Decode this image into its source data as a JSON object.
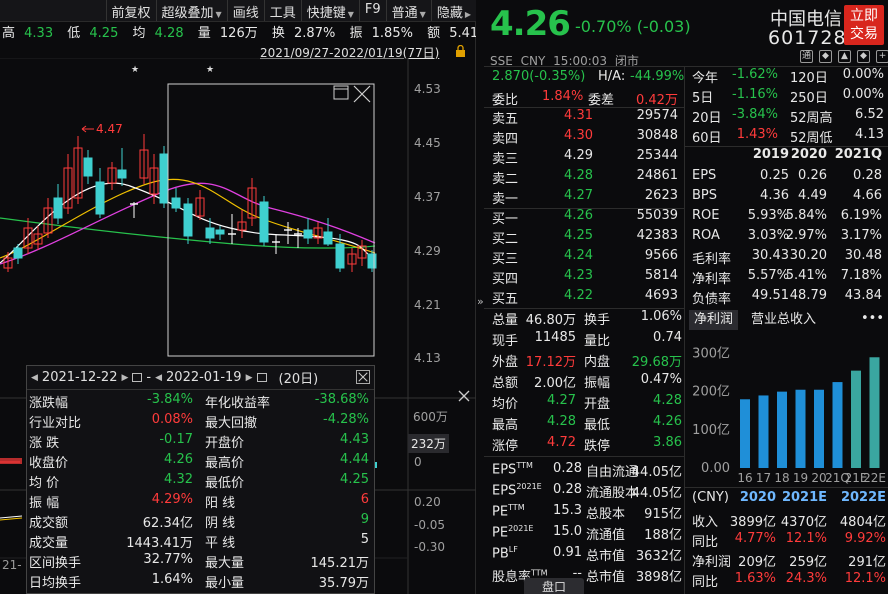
{
  "toolbar": {
    "items": [
      "前复权",
      "超级叠加",
      "画线",
      "工具",
      "快捷键",
      "F9",
      "普通",
      "隐藏"
    ]
  },
  "stats_line": {
    "high_label": "高",
    "high": "4.33",
    "low_label": "低",
    "low": "4.25",
    "avg_label": "均",
    "avg": "4.28",
    "vol_label": "量",
    "vol": "126万",
    "turnover_label": "换",
    "turnover": "2.87%",
    "amp_label": "振",
    "amp": "1.85%",
    "amount_label": "额",
    "amount": "5.41亿"
  },
  "range_text": "2021/09/27-2022/01/19(77日)",
  "main_chart": {
    "yticks": [
      "4.53",
      "4.45",
      "4.37",
      "4.29",
      "4.21",
      "4.13"
    ],
    "peak_label": "4.47",
    "star_mark": "★",
    "colors": {
      "up": "#ff3b3b",
      "down": "#3fd0d0",
      "ma5": "#ffffff",
      "ma10": "#f0c000",
      "ma20": "#e040e0",
      "ma60": "#27c24c"
    }
  },
  "popup": {
    "start_date": "2021-12-22",
    "sep": "-",
    "end_date": "2022-01-19",
    "days": "(20日)",
    "rows": [
      {
        "l1": "涨跌幅",
        "v1": "-3.84%",
        "c1": "dn",
        "l2": "年化收益率",
        "v2": "-38.68%",
        "c2": "dn"
      },
      {
        "l1": "行业对比",
        "v1": "0.08%",
        "c1": "up",
        "l2": "最大回撤",
        "v2": "-4.28%",
        "c2": "dn"
      },
      {
        "l1": "涨    跌",
        "v1": "-0.17",
        "c1": "dn",
        "l2": "开盘价",
        "v2": "4.43",
        "c2": "dn"
      },
      {
        "l1": "收盘价",
        "v1": "4.26",
        "c1": "dn",
        "l2": "最高价",
        "v2": "4.44",
        "c2": "dn"
      },
      {
        "l1": "均    价",
        "v1": "4.32",
        "c1": "dn",
        "l2": "最低价",
        "v2": "4.25",
        "c2": "dn"
      },
      {
        "l1": "振    幅",
        "v1": "4.29%",
        "c1": "up",
        "l2": "阳    线",
        "v2": "6",
        "c2": "up"
      },
      {
        "l1": "成交额",
        "v1": "62.34亿",
        "c1": "wh",
        "l2": "阴    线",
        "v2": "9",
        "c2": "dn"
      },
      {
        "l1": "成交量",
        "v1": "1443.41万",
        "c1": "wh",
        "l2": "平    线",
        "v2": "5",
        "c2": "wh"
      },
      {
        "l1": "区间换手",
        "v1": "32.77%",
        "c1": "wh",
        "l2": "最大量",
        "v2": "145.21万",
        "c2": "wh"
      },
      {
        "l1": "日均换手",
        "v1": "1.64%",
        "c1": "wh",
        "l2": "最小量",
        "v2": "35.79万",
        "c2": "wh"
      }
    ]
  },
  "vol_pane": {
    "label_top": "600万",
    "badge": "232万",
    "label_zero": "0"
  },
  "macd_pane": {
    "label_a": "0.20",
    "label_b": "-0.05",
    "label_c": "-0.30"
  },
  "bottom_left_label": "21-",
  "quote": {
    "price": "4.26",
    "change": "-0.70% (-0.03)",
    "name": "中国电信",
    "code": "601728",
    "trade_button": "立即交易",
    "exchange": "SSE",
    "currency": "CNY",
    "time": "15:00:03",
    "status": "闭市",
    "comp_value": "2.870(-0.35%)",
    "ha_label": "H/A:",
    "ha_value": "-44.99%"
  },
  "orderbook": {
    "ratio": {
      "l1": "委比",
      "v1": "1.84%",
      "l2": "委差",
      "v2": "0.42万"
    },
    "asks": [
      {
        "label": "卖五",
        "price": "4.31",
        "vol": "29574",
        "pc": "up"
      },
      {
        "label": "卖四",
        "price": "4.30",
        "vol": "30848",
        "pc": "up"
      },
      {
        "label": "卖三",
        "price": "4.29",
        "vol": "25344",
        "pc": "wh"
      },
      {
        "label": "卖二",
        "price": "4.28",
        "vol": "24861",
        "pc": "dn"
      },
      {
        "label": "卖一",
        "price": "4.27",
        "vol": "2623",
        "pc": "dn"
      }
    ],
    "bids": [
      {
        "label": "买一",
        "price": "4.26",
        "vol": "55039",
        "pc": "dn"
      },
      {
        "label": "买二",
        "price": "4.25",
        "vol": "42383",
        "pc": "dn"
      },
      {
        "label": "买三",
        "price": "4.24",
        "vol": "9566",
        "pc": "dn"
      },
      {
        "label": "买四",
        "price": "4.23",
        "vol": "5814",
        "pc": "dn"
      },
      {
        "label": "买五",
        "price": "4.22",
        "vol": "4693",
        "pc": "dn"
      }
    ]
  },
  "stats": [
    {
      "k1": "总量",
      "v1": "46.80万",
      "c1": "wh",
      "k2": "换手",
      "v2": "1.06%",
      "c2": "wh"
    },
    {
      "k1": "现手",
      "v1": "11485",
      "c1": "wh",
      "k2": "量比",
      "v2": "0.74",
      "c2": "wh"
    },
    {
      "k1": "外盘",
      "v1": "17.12万",
      "c1": "up",
      "k2": "内盘",
      "v2": "29.68万",
      "c2": "dn"
    },
    {
      "k1": "总额",
      "v1": "2.00亿",
      "c1": "wh",
      "k2": "振幅",
      "v2": "0.47%",
      "c2": "wh"
    },
    {
      "k1": "均价",
      "v1": "4.27",
      "c1": "dn",
      "k2": "开盘",
      "v2": "4.28",
      "c2": "dn"
    },
    {
      "k1": "最高",
      "v1": "4.28",
      "c1": "dn",
      "k2": "最低",
      "v2": "4.26",
      "c2": "dn"
    },
    {
      "k1": "涨停",
      "v1": "4.72",
      "c1": "up",
      "k2": "跌停",
      "v2": "3.86",
      "c2": "dn"
    }
  ],
  "valuation": [
    {
      "k1": "EPS",
      "s1": "TTM",
      "v1": "0.28",
      "k2": "自由流通",
      "v2": "44.05亿"
    },
    {
      "k1": "EPS",
      "s1": "2021E",
      "v1": "0.28",
      "k2": "流通股本",
      "v2": "44.05亿"
    },
    {
      "k1": "PE",
      "s1": "TTM",
      "v1": "15.3",
      "k2": "总股本",
      "v2": "915亿"
    },
    {
      "k1": "PE",
      "s1": "2021E",
      "v1": "15.0",
      "k2": "流通值",
      "v2": "188亿"
    },
    {
      "k1": "PB",
      "s1": "LF",
      "v1": "0.91",
      "k2": "总市值",
      "v2": "3632亿"
    },
    {
      "k1": "股息率",
      "s1": "TTM",
      "v1": "--",
      "k2": "总市值",
      "v2": "3898亿"
    }
  ],
  "performance": [
    {
      "k1": "今年",
      "v1": "-1.62%",
      "c1": "dn",
      "k2": "120日",
      "v2": "0.00%",
      "c2": "wh"
    },
    {
      "k1": "5日",
      "v1": "-1.16%",
      "c1": "dn",
      "k2": "250日",
      "v2": "0.00%",
      "c2": "wh"
    },
    {
      "k1": "20日",
      "v1": "-3.84%",
      "c1": "dn",
      "k2": "52周高",
      "v2": "6.52",
      "c2": "wh"
    },
    {
      "k1": "60日",
      "v1": "1.43%",
      "c1": "up",
      "k2": "52周低",
      "v2": "4.13",
      "c2": "wh"
    }
  ],
  "fin_table": {
    "years": [
      "2019",
      "2020",
      "2021Q"
    ],
    "rows": [
      {
        "k": "EPS",
        "v": [
          "0.25",
          "0.26",
          "0.28"
        ]
      },
      {
        "k": "BPS",
        "v": [
          "4.36",
          "4.49",
          "4.66"
        ]
      },
      {
        "k": "ROE",
        "v": [
          "5.93%",
          "5.84%",
          "6.19%"
        ]
      },
      {
        "k": "ROA",
        "v": [
          "3.03%",
          "2.97%",
          "3.17%"
        ]
      },
      {
        "k": "毛利率",
        "v": [
          "30.43",
          "30.20",
          "30.48"
        ]
      },
      {
        "k": "净利率",
        "v": [
          "5.57%",
          "5.41%",
          "7.18%"
        ]
      },
      {
        "k": "负债率",
        "v": [
          "49.51",
          "48.79",
          "43.84"
        ]
      }
    ]
  },
  "tabs": {
    "net": "净利润",
    "rev": "营业总收入",
    "more": "•••"
  },
  "chart_data": {
    "type": "bar",
    "categories": [
      "16",
      "17",
      "18",
      "19",
      "20",
      "21Q",
      "21E",
      "22E"
    ],
    "values": [
      180,
      190,
      200,
      205,
      205,
      225,
      255,
      290
    ],
    "yticks": [
      "300亿",
      "200亿",
      "100亿",
      "0.00"
    ],
    "ylim": [
      0,
      330
    ],
    "colors": {
      "actual": "#1f8fd8",
      "estimate": "#3aa6a0"
    }
  },
  "forecast": {
    "head": [
      "(CNY)",
      "2020",
      "2021E",
      "2022E"
    ],
    "rows": [
      {
        "k": "收入",
        "v": [
          "3899亿",
          "4370亿",
          "4804亿"
        ],
        "c": "wh"
      },
      {
        "k": "同比",
        "v": [
          "4.77%",
          "12.1%",
          "9.92%"
        ],
        "c": "up"
      },
      {
        "k": "净利润",
        "v": [
          "209亿",
          "259亿",
          "291亿"
        ],
        "c": "wh"
      },
      {
        "k": "同比",
        "v": [
          "1.63%",
          "24.3%",
          "12.1%"
        ],
        "c": "up"
      }
    ]
  },
  "bottom_tab": "盘口"
}
